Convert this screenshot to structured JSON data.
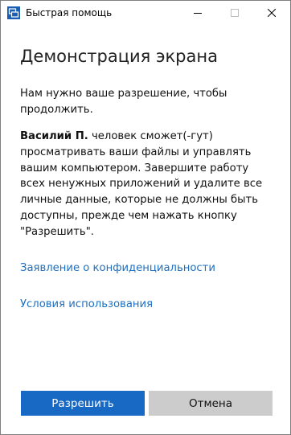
{
  "window": {
    "title": "Быстрая помощь",
    "app_icon": "quick-assist-icon"
  },
  "titlebar_buttons": {
    "minimize_icon": "minimize-icon",
    "maximize_icon": "maximize-icon",
    "close_icon": "close-icon"
  },
  "content": {
    "heading": "Демонстрация экрана",
    "paragraph1": "Нам нужно ваше разрешение, чтобы продолжить.",
    "user_name": "Василий П.",
    "paragraph2_rest": " человек сможет(-гут) просматривать ваши файлы и управлять вашим компьютером. Завершите работу всех ненужных приложений и удалите все личные данные, которые не должны быть доступны, прежде чем нажать кнопку \"Разрешить\"."
  },
  "links": {
    "privacy": "Заявление о конфиденциальности",
    "terms": "Условия использования"
  },
  "buttons": {
    "allow": "Разрешить",
    "cancel": "Отмена"
  },
  "colors": {
    "accent": "#1769c3",
    "link": "#1f6fbf",
    "secondary_button": "#cccccc"
  }
}
